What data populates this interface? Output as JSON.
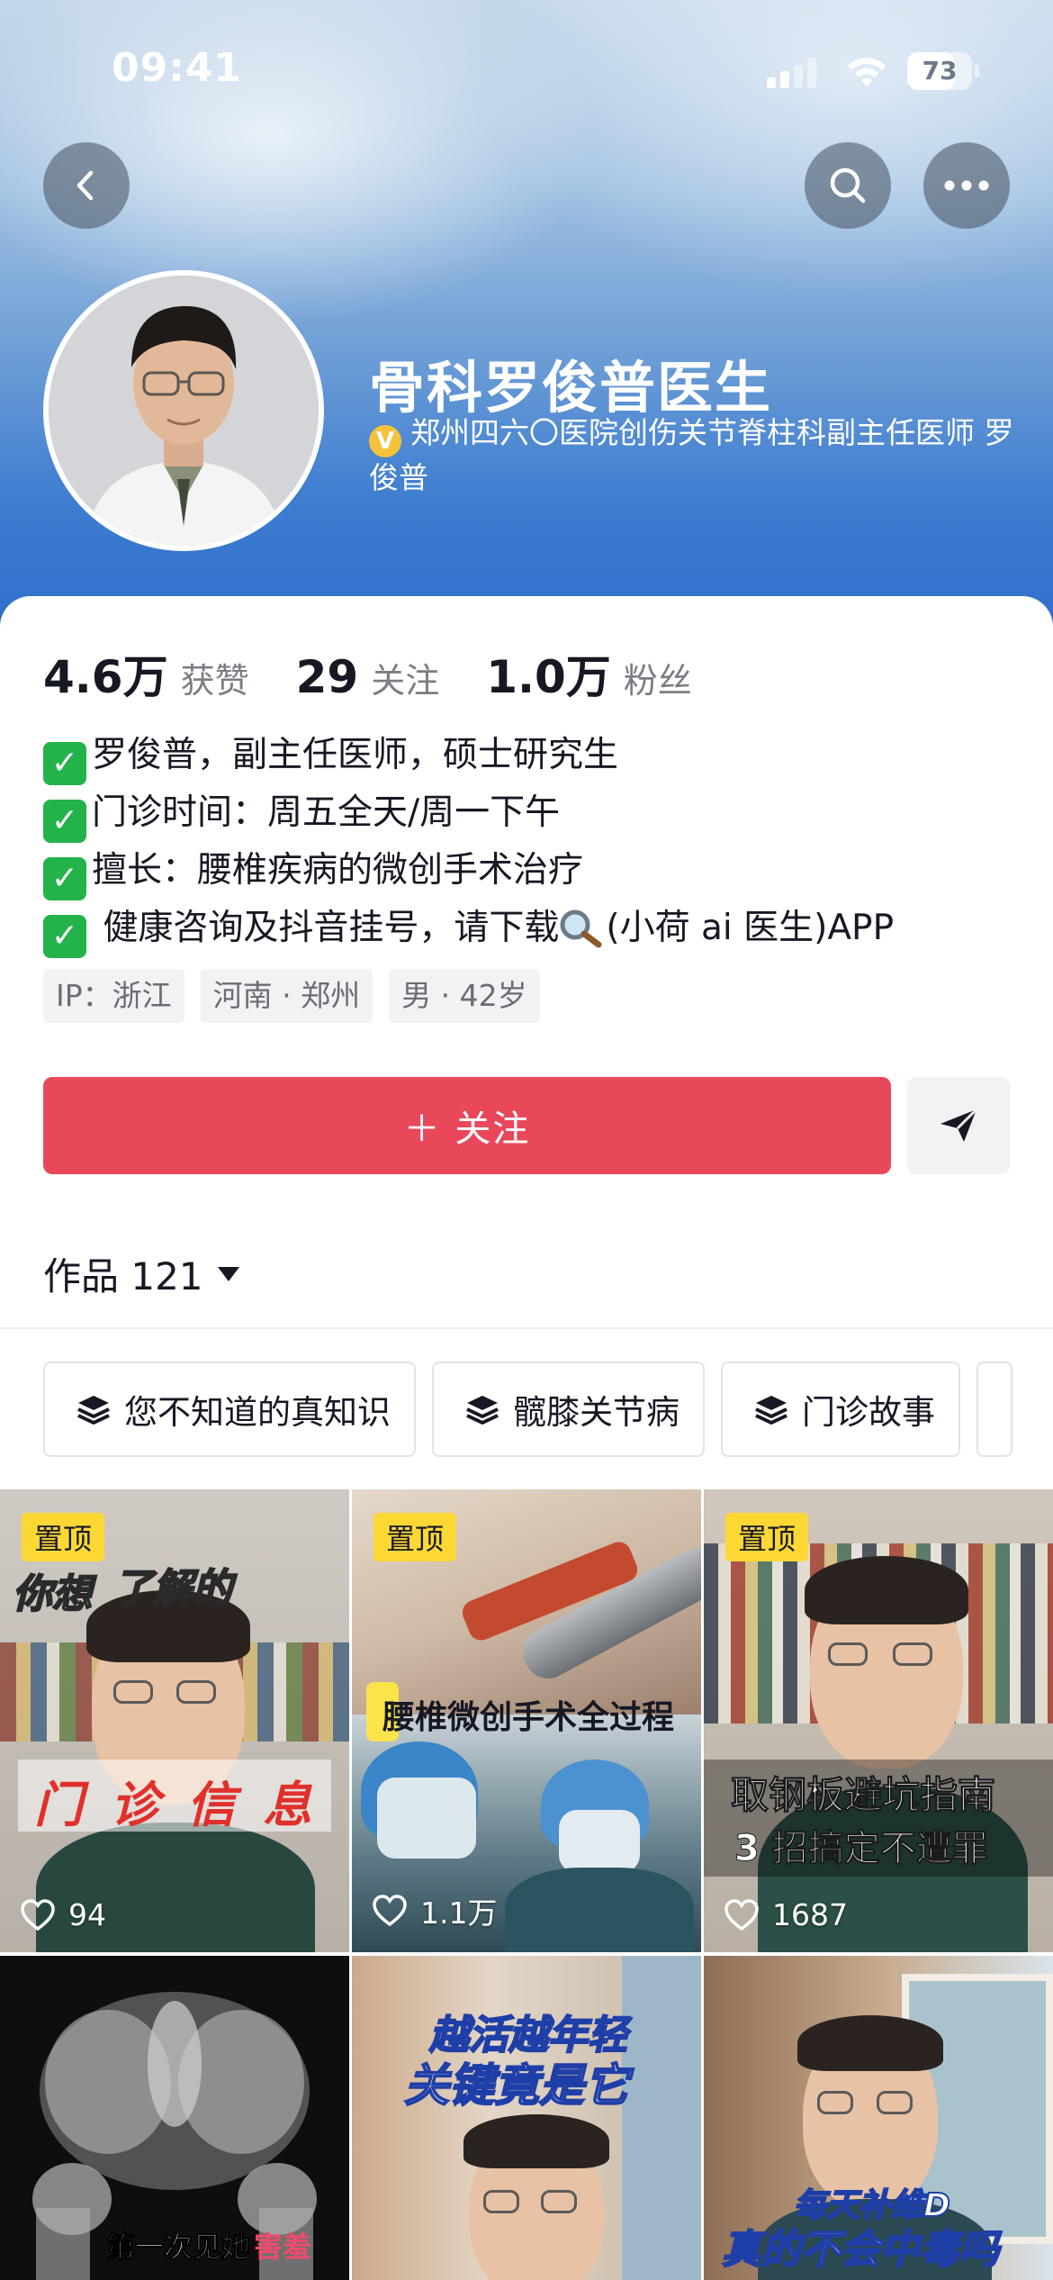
{
  "status_bar": {
    "time": "09:41",
    "battery": "73",
    "battery_level": 0.73
  },
  "profile": {
    "name": "骨科罗俊普医生",
    "verify_badge": "V",
    "verification": "郑州四六〇医院创伤关节脊柱科副主任医师 罗俊普"
  },
  "stats": [
    {
      "value": "4.6万",
      "label": "获赞"
    },
    {
      "value": "29",
      "label": "关注"
    },
    {
      "value": "1.0万",
      "label": "粉丝"
    }
  ],
  "bio": {
    "check_mark": "✓",
    "lines": [
      "罗俊普，副主任医师，硕士研究生",
      "门诊时间：周五全天/周一下午",
      "擅长：腰椎疾病的微创手术治疗"
    ],
    "line4_prefix": " 健康咨询及抖音挂号，请下载",
    "line4_suffix": "(小荷 ai 医生)APP"
  },
  "tags": [
    "IP：浙江",
    "河南 · 郑州",
    "男 · 42岁"
  ],
  "actions": {
    "follow_label": "＋ 关注"
  },
  "works": {
    "label": "作品 121"
  },
  "collections": [
    "您不知道的真知识",
    "髋膝关节病",
    "门诊故事"
  ],
  "videos": [
    {
      "pinned": "置顶",
      "likes": "94",
      "caption_top": "你想",
      "caption_top2": "了解的",
      "caption_main": "门 诊 信 息"
    },
    {
      "pinned": "置顶",
      "likes": "1.1万",
      "caption_main": "腰椎微创手术全过程"
    },
    {
      "pinned": "置顶",
      "likes": "1687",
      "caption_main": "取钢板避坑指南",
      "caption_sub": "3 招搞定不遭罪"
    },
    {
      "caption_main": "第一次见她",
      "caption_accent": "害羞"
    },
    {
      "caption_main": "越活越年轻",
      "caption_sub": "关键竟是它"
    },
    {
      "caption_main": "每天补维D",
      "caption_sub": "真的不会中毒吗"
    }
  ]
}
